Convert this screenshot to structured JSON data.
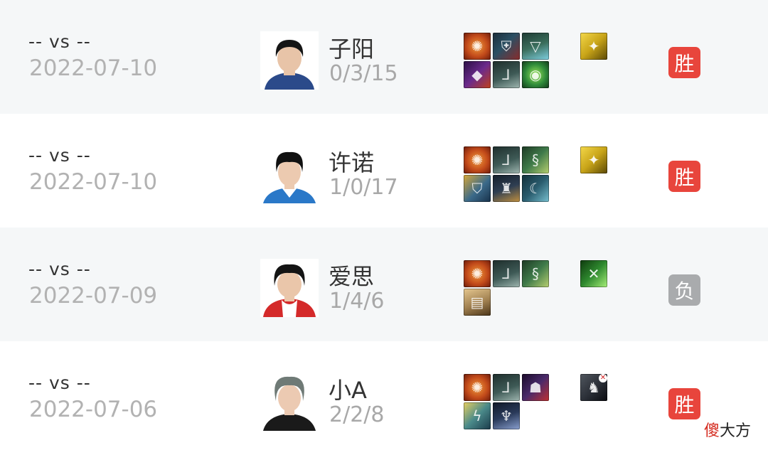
{
  "matches": [
    {
      "vs": "-- vs --",
      "date": "2022-07-10",
      "player": "子阳",
      "kda": "0/3/15",
      "result": "胜",
      "result_type": "win",
      "items": [
        {
          "icon": "crest-icon",
          "color": "#c24a1a"
        },
        {
          "icon": "armor-icon",
          "color": "#2a4f63"
        },
        {
          "icon": "pendant-icon",
          "color": "#3b6e5c"
        },
        {
          "icon": "purple-gem-icon",
          "color": "#6b2a8c"
        },
        {
          "icon": "boots-icon",
          "color": "#3e5a56"
        },
        {
          "icon": "green-orb-icon",
          "color": "#2f8a3a"
        }
      ],
      "spell": {
        "icon": "flash-spell-icon",
        "color": "#c8a418"
      },
      "avatar": {
        "hair": "#151515",
        "shirt": "#2b4a8a",
        "skin": "#e8c4a8"
      }
    },
    {
      "vs": "-- vs --",
      "date": "2022-07-10",
      "player": "许诺",
      "kda": "1/0/17",
      "result": "胜",
      "result_type": "win",
      "items": [
        {
          "icon": "crest-icon",
          "color": "#c24a1a"
        },
        {
          "icon": "boots-icon",
          "color": "#3e5a56"
        },
        {
          "icon": "serpent-icon",
          "color": "#3f7a4a"
        },
        {
          "icon": "golden-shield-icon",
          "color": "#3b6a8a"
        },
        {
          "icon": "knight-armor-icon",
          "color": "#2e3e52"
        },
        {
          "icon": "blade-icon",
          "color": "#2a5c6e"
        }
      ],
      "spell": {
        "icon": "flash-spell-icon",
        "color": "#c8a418"
      },
      "avatar": {
        "hair": "#111111",
        "shirt": "#2a78c8",
        "skin": "#eccab0"
      }
    },
    {
      "vs": "-- vs --",
      "date": "2022-07-09",
      "player": "爱思",
      "kda": "1/4/6",
      "result": "负",
      "result_type": "loss",
      "items": [
        {
          "icon": "crest-icon",
          "color": "#c24a1a"
        },
        {
          "icon": "boots-icon",
          "color": "#3e5a56"
        },
        {
          "icon": "serpent-icon",
          "color": "#3f7a4a"
        },
        {
          "icon": "scroll-icon",
          "color": "#a08050"
        }
      ],
      "spell": {
        "icon": "dash-spell-icon",
        "color": "#2f8a2f"
      },
      "avatar": {
        "hair": "#141414",
        "shirt": "#d42a2a",
        "skin": "#eac6aa"
      }
    },
    {
      "vs": "-- vs --",
      "date": "2022-07-06",
      "player": "小A",
      "kda": "2/2/8",
      "result": "胜",
      "result_type": "win",
      "items": [
        {
          "icon": "crest-icon",
          "color": "#c24a1a"
        },
        {
          "icon": "boots-icon",
          "color": "#3e5a56"
        },
        {
          "icon": "dark-mask-icon",
          "color": "#4a2a6a"
        },
        {
          "icon": "lightning-blade-icon",
          "color": "#4a8a8a"
        },
        {
          "icon": "spirit-armor-icon",
          "color": "#2a3a5a"
        }
      ],
      "spell": {
        "icon": "execute-spell-icon",
        "color": "#2a2e36",
        "disabled": true
      },
      "avatar": {
        "hair": "#6f7a76",
        "shirt": "#1a1a1a",
        "skin": "#eccab2"
      }
    }
  ],
  "watermark": {
    "first": "傻",
    "rest": "大方"
  }
}
